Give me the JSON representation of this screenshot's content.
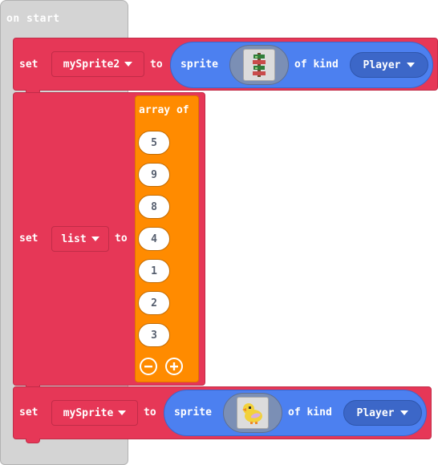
{
  "hat": {
    "label": "on start"
  },
  "blocks": [
    {
      "set_label": "set",
      "variable": "mySprite2",
      "to_label": "to",
      "sprite_label": "sprite",
      "image_icon": "tree-sprite-icon",
      "of_kind_label": "of kind",
      "kind": "Player"
    },
    {
      "set_label": "set",
      "variable": "list",
      "to_label": "to",
      "array_label": "array of",
      "values": [
        "5",
        "9",
        "8",
        "4",
        "1",
        "2",
        "3"
      ],
      "remove_icon": "minus-circle-icon",
      "add_icon": "plus-circle-icon"
    },
    {
      "set_label": "set",
      "variable": "mySprite",
      "to_label": "to",
      "sprite_label": "sprite",
      "image_icon": "duck-sprite-icon",
      "of_kind_label": "of kind",
      "kind": "Player"
    }
  ],
  "colors": {
    "set_block": "#e63757",
    "sprite_block": "#4c80f0",
    "array_block": "#ff8b00",
    "hat_block": "#d4d4d4"
  }
}
